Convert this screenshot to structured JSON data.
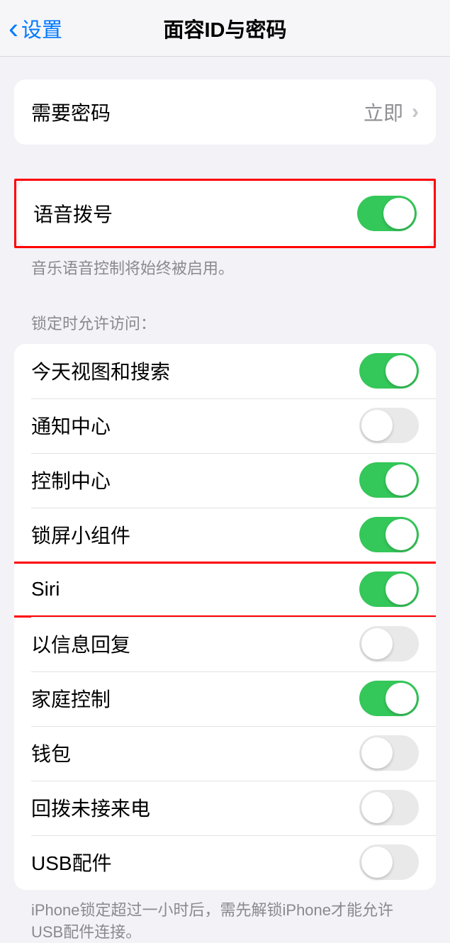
{
  "header": {
    "back_label": "设置",
    "title": "面容ID与密码"
  },
  "require_passcode": {
    "label": "需要密码",
    "value": "立即"
  },
  "voice_dial": {
    "label": "语音拨号",
    "footer": "音乐语音控制将始终被启用。"
  },
  "lock_access": {
    "header": "锁定时允许访问：",
    "items": [
      {
        "label": "今天视图和搜索",
        "on": true
      },
      {
        "label": "通知中心",
        "on": false
      },
      {
        "label": "控制中心",
        "on": true
      },
      {
        "label": "锁屏小组件",
        "on": true
      },
      {
        "label": "Siri",
        "on": true
      },
      {
        "label": "以信息回复",
        "on": false
      },
      {
        "label": "家庭控制",
        "on": true
      },
      {
        "label": "钱包",
        "on": false
      },
      {
        "label": "回拨未接来电",
        "on": false
      },
      {
        "label": "USB配件",
        "on": false
      }
    ],
    "footer": "iPhone锁定超过一小时后，需先解锁iPhone才能允许USB配件连接。"
  }
}
